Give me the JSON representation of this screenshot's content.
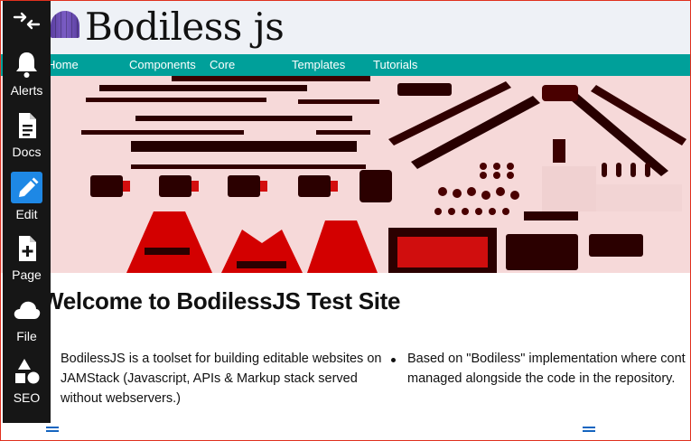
{
  "header": {
    "logo_text": "Bodiless js"
  },
  "nav": {
    "items": [
      {
        "label": "Home"
      },
      {
        "label": "Components"
      },
      {
        "label": "Core"
      },
      {
        "label": "Templates"
      },
      {
        "label": "Tutorials"
      }
    ]
  },
  "admin_menu": {
    "items": [
      {
        "label": "",
        "icon": "swap-arrows-icon"
      },
      {
        "label": "Alerts",
        "icon": "bell-icon"
      },
      {
        "label": "Docs",
        "icon": "document-icon"
      },
      {
        "label": "Edit",
        "icon": "pencil-icon",
        "active": true
      },
      {
        "label": "Page",
        "icon": "new-page-icon"
      },
      {
        "label": "File",
        "icon": "cloud-icon"
      },
      {
        "label": "SEO",
        "icon": "shapes-icon"
      }
    ]
  },
  "hero": {
    "image": "robot-parts-flat-lay-red-tint"
  },
  "main": {
    "title": "Welcome to BodilessJS Test Site",
    "left_text": "BodilessJS is a toolset for building editable websites on JAMStack (Javascript, APIs & Markup stack served without webservers.)",
    "right_line1": "Based on \"Bodiless\" implementation where cont",
    "right_line2": "managed alongside the code in the repository."
  },
  "colors": {
    "nav_background": "#00a09a",
    "admin_background": "#161616",
    "active_accent": "#1e88e5",
    "hero_tint": "#ff0000"
  }
}
